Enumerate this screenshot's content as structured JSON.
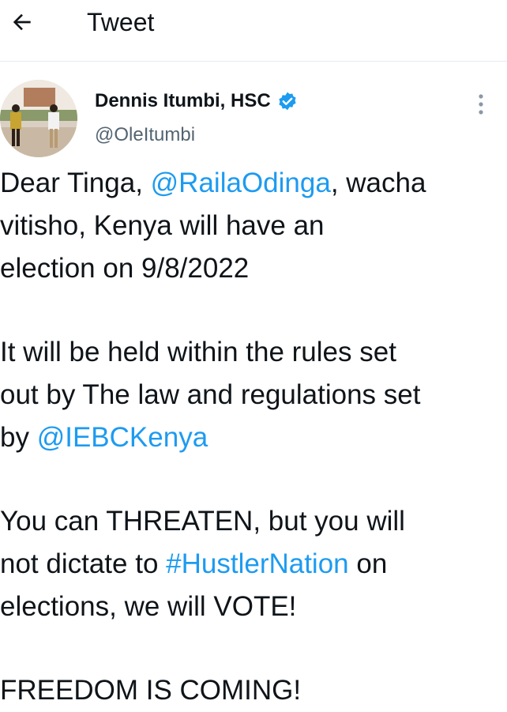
{
  "header": {
    "title": "Tweet"
  },
  "author": {
    "name": "Dennis Itumbi, HSC",
    "handle": "@OleItumbi",
    "verified": true
  },
  "tweet": {
    "paragraphs": [
      [
        [
          {
            "t": "Dear Tinga, "
          },
          {
            "t": "@RailaOdinga",
            "link": true
          },
          {
            "t": ", wacha"
          }
        ],
        [
          {
            "t": "vitisho, Kenya will have an"
          }
        ],
        [
          {
            "t": "election on 9/8/2022"
          }
        ]
      ],
      [
        [
          {
            "t": "It will be held within the rules set"
          }
        ],
        [
          {
            "t": "out by The law and regulations set"
          }
        ],
        [
          {
            "t": "by  "
          },
          {
            "t": "@IEBCKenya",
            "link": true
          }
        ]
      ],
      [
        [
          {
            "t": "You can THREATEN, but you will"
          }
        ],
        [
          {
            "t": "not dictate to "
          },
          {
            "t": "#HustlerNation",
            "link": true
          },
          {
            "t": " on"
          }
        ],
        [
          {
            "t": "elections, we will VOTE!"
          }
        ]
      ],
      [
        [
          {
            "t": "FREEDOM IS COMING!"
          }
        ]
      ]
    ]
  },
  "colors": {
    "link": "#1d9bf0",
    "text": "#0f1419",
    "muted": "#536471",
    "divider": "#e6ecf0"
  },
  "icons": {
    "back": "arrow-left-icon",
    "verified": "verified-badge-icon",
    "more": "more-vertical-icon"
  }
}
